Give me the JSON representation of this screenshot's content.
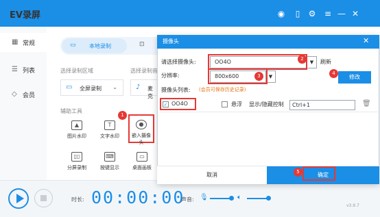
{
  "app": {
    "title": "EV录屏",
    "version": "v3.9.7"
  },
  "sidebar": {
    "items": [
      {
        "label": "常规",
        "icon": "grid-icon"
      },
      {
        "label": "列表",
        "icon": "list-icon"
      },
      {
        "label": "会员",
        "icon": "diamond-icon"
      }
    ]
  },
  "main": {
    "tab_local": "本地录制",
    "area_label": "选择录制区域",
    "area_value": "全屏录制",
    "audio_label": "选择录制音",
    "audio_value": "麦克",
    "tools_label": "辅助工具",
    "tools": [
      "图片水印",
      "文字水印",
      "嵌入摄像头",
      "分屏录制",
      "按键显示",
      "桌面画板"
    ]
  },
  "bottom": {
    "duration_label": "时长:",
    "timer": "00:00:00",
    "volume_label": "声音:"
  },
  "dialog": {
    "title": "摄像头",
    "camera_select_label": "请选择摄像头:",
    "camera_value": "OO4O",
    "refresh": "刷新",
    "resolution_label": "分辨率:",
    "resolution_value": "800x600",
    "modify": "修改",
    "camera_list_label": "摄像头列表:",
    "member_note": "(会员可保存历史记录)",
    "list_camera_name": "OO4O",
    "float_label": "悬浮",
    "toggle_label": "显示/隐藏控制",
    "shortcut": "Ctrl+1",
    "cancel": "取消",
    "confirm": "确定"
  },
  "badges": [
    "1",
    "2",
    "3",
    "4",
    "5"
  ],
  "colors": {
    "accent": "#1b8ee6",
    "highlight": "#e53935"
  }
}
